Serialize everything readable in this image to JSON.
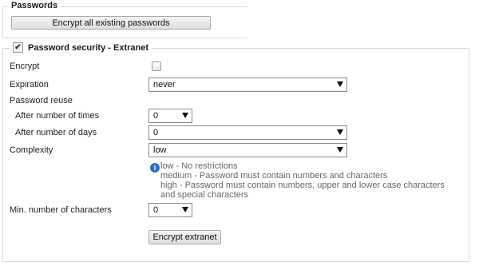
{
  "passwords_section": {
    "legend": "Passwords",
    "encrypt_all_button": "Encrypt all existing passwords"
  },
  "extranet_section": {
    "legend": "Password security - Extranet",
    "legend_checked": true,
    "encrypt_label": "Encrypt",
    "expiration_label": "Expiration",
    "expiration_value": "never",
    "password_reuse_label": "Password reuse",
    "after_times_label": "After number of times",
    "after_times_value": "0",
    "after_days_label": "After number of days",
    "after_days_value": "0",
    "complexity_label": "Complexity",
    "complexity_value": "low",
    "complexity_hint": {
      "line1": "low - No restrictions",
      "line2": "medium - Password must contain numbers and characters",
      "line3": "high - Password must contain numbers, upper and lower case characters",
      "line4": "and special characters"
    },
    "min_chars_label": "Min. number of characters",
    "min_chars_value": "0",
    "encrypt_extranet_button": "Encrypt extranet"
  }
}
